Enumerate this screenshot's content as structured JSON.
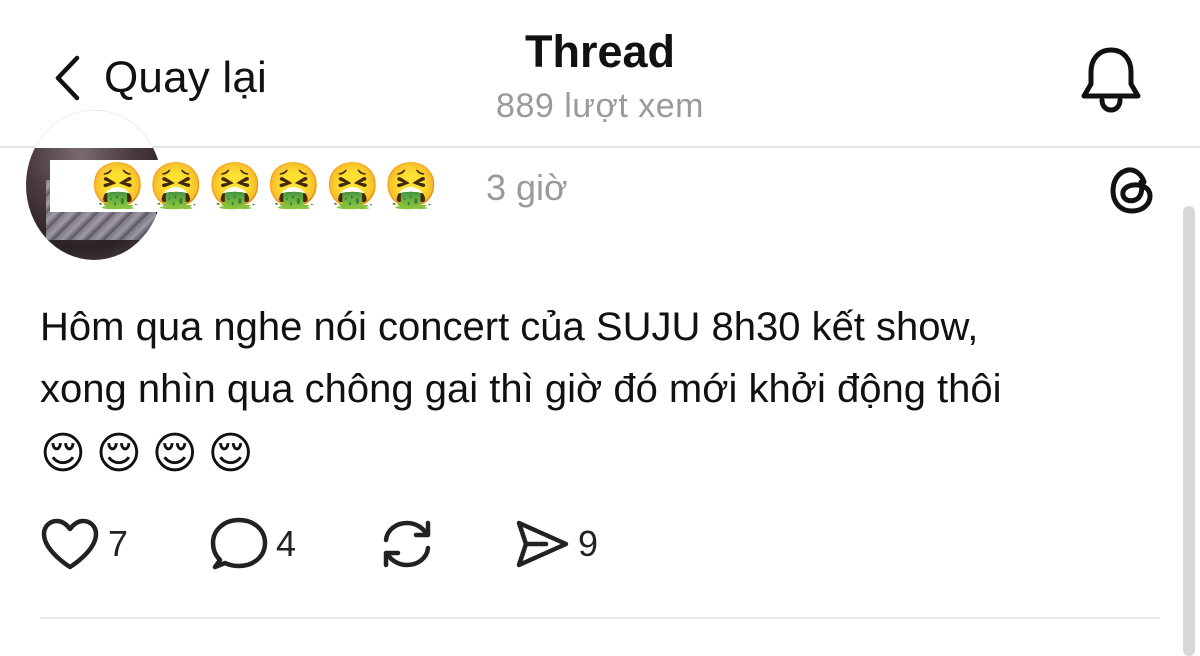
{
  "header": {
    "back_label": "Quay lại",
    "title": "Thread",
    "views": "889 lượt xem"
  },
  "post": {
    "username_emoji": "🤮🤮🤮🤮🤮🤮",
    "timestamp": "3 giờ",
    "text_line_1": "Hôm qua nghe nói concert của SUJU 8h30 kết show,",
    "text_line_2": "xong nhìn qua chông gai thì giờ đó mới khởi động thôi",
    "text_emoji": "😌😌😌😌",
    "likes": "7",
    "replies": "4",
    "shares": "9"
  },
  "icons": {
    "back": "chevron-left-icon",
    "notifications": "bell-icon",
    "app": "threads-logo-icon",
    "like": "heart-icon",
    "reply": "comment-icon",
    "repost": "repost-icon",
    "share": "send-icon"
  },
  "colors": {
    "text": "#111111",
    "muted": "#9a9a9a",
    "divider": "#e4e4e4",
    "background": "#ffffff"
  }
}
